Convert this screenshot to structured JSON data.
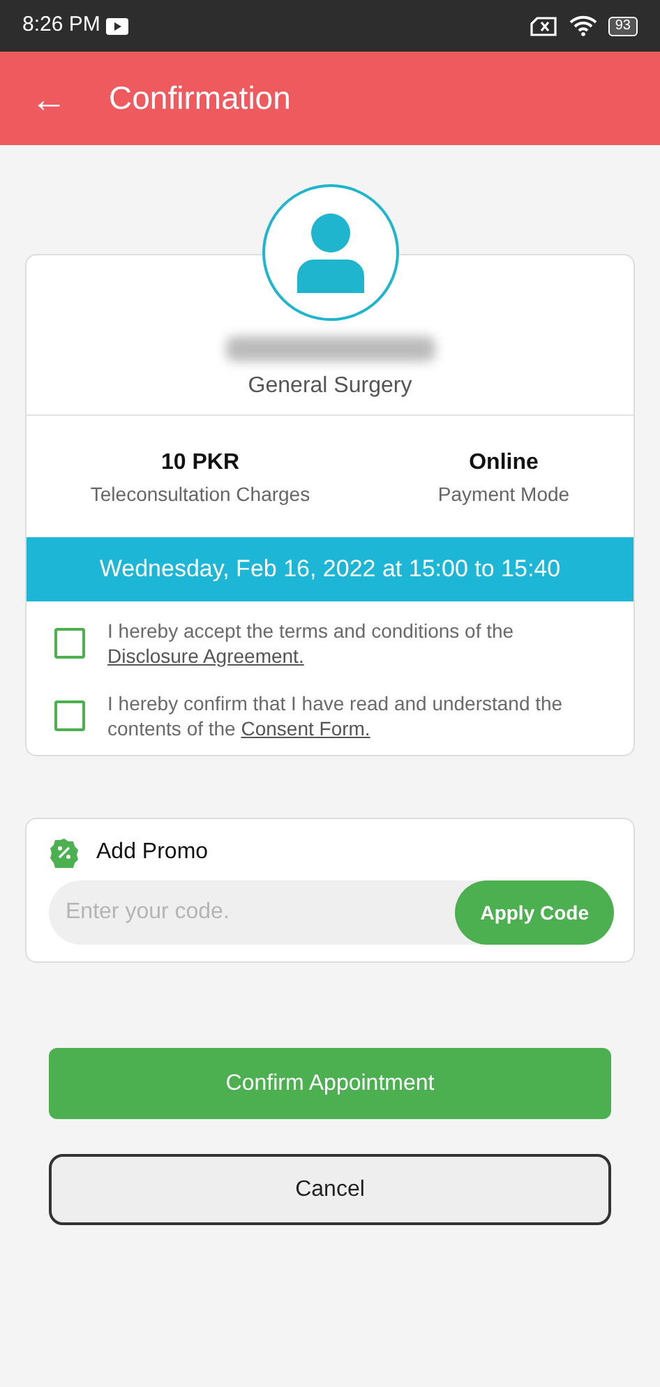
{
  "status_bar": {
    "time": "8:26 PM",
    "battery": "93"
  },
  "header": {
    "back": "←",
    "title": "Confirmation"
  },
  "doctor": {
    "specialty": "General Surgery"
  },
  "summary": [
    {
      "value": "10 PKR",
      "label": "Teleconsultation Charges"
    },
    {
      "value": "Online",
      "label": "Payment Mode"
    }
  ],
  "schedule": "Wednesday, Feb 16, 2022 at 15:00 to 15:40",
  "agreements": [
    {
      "text": "I hereby accept the terms and conditions of the ",
      "link": "Disclosure Agreement.",
      "checked": false
    },
    {
      "text": "I hereby confirm that I have read and understand the contents of the ",
      "link": "Consent Form.",
      "checked": false
    }
  ],
  "promo": {
    "title": "Add Promo",
    "placeholder": "Enter your code.",
    "button": "Apply Code"
  },
  "buttons": [
    {
      "kind": "primary",
      "label": "Confirm Appointment"
    },
    {
      "kind": "secondary",
      "label": "Cancel"
    }
  ]
}
